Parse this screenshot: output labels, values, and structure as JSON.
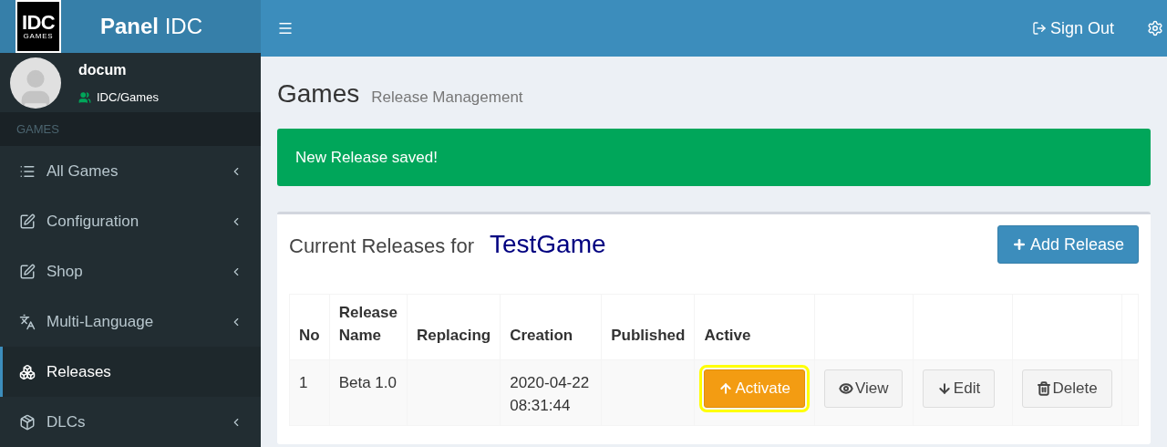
{
  "brand": {
    "logo_top": "IDC",
    "logo_bottom": "GAMES",
    "title_bold": "Panel",
    "title_rest": "IDC"
  },
  "topbar": {
    "sign_out": "Sign Out"
  },
  "user": {
    "name": "docum",
    "group": "IDC/Games"
  },
  "sidebar": {
    "section": "GAMES",
    "items": [
      {
        "label": "All Games",
        "selected": false,
        "expandable": true
      },
      {
        "label": "Configuration",
        "selected": false,
        "expandable": true
      },
      {
        "label": "Shop",
        "selected": false,
        "expandable": true
      },
      {
        "label": "Multi-Language",
        "selected": false,
        "expandable": true
      },
      {
        "label": "Releases",
        "selected": true,
        "expandable": false
      },
      {
        "label": "DLCs",
        "selected": false,
        "expandable": true
      }
    ]
  },
  "page": {
    "title": "Games",
    "subtitle": "Release Management"
  },
  "alert": {
    "message": "New Release saved!"
  },
  "card": {
    "heading": "Current Releases for",
    "game": "TestGame",
    "add_button": "Add Release"
  },
  "table": {
    "columns": [
      "No",
      "Release Name",
      "Replacing",
      "Creation",
      "Published",
      "Active"
    ],
    "rows": [
      {
        "cells": [
          "1",
          "Beta 1.0",
          "",
          "2020-04-22 08:31:44",
          ""
        ],
        "actions": [
          {
            "kind": "activate",
            "label": "Activate",
            "highlighted": true
          },
          {
            "kind": "view",
            "label": "View",
            "highlighted": false
          },
          {
            "kind": "edit",
            "label": "Edit",
            "highlighted": false
          },
          {
            "kind": "delete",
            "label": "Delete",
            "highlighted": false
          }
        ]
      }
    ]
  }
}
